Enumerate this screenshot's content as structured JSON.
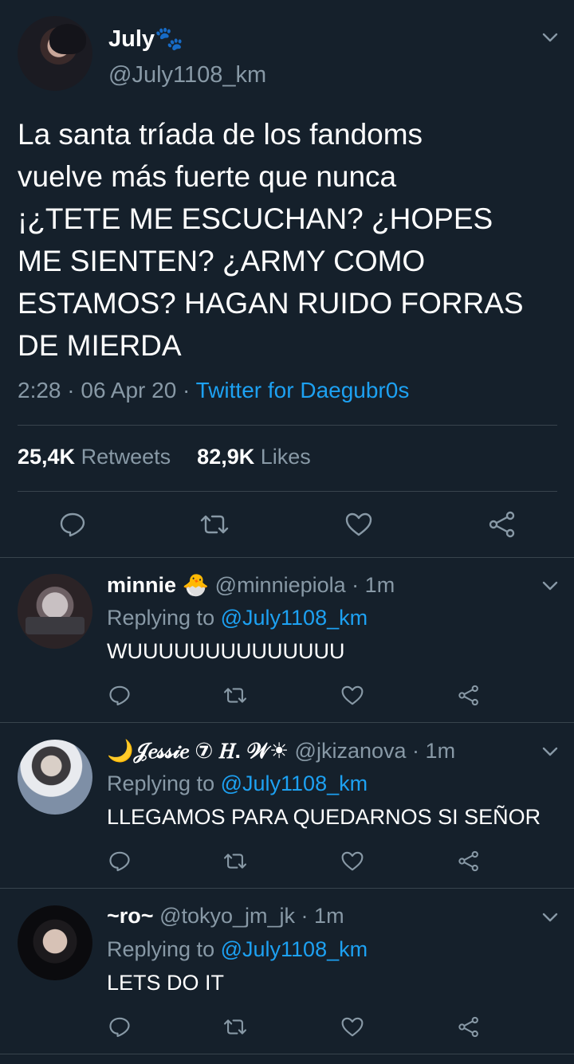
{
  "main_tweet": {
    "display_name": "July🐾",
    "handle": "@July1108_km",
    "text_lines": [
      "La santa tríada de los fandoms",
      "vuelve más fuerte que nunca",
      "¡¿TETE ME ESCUCHAN? ¿HOPES",
      "ME SIENTEN? ¿ARMY COMO",
      "ESTAMOS? HAGAN RUIDO FORRAS",
      "DE MIERDA"
    ],
    "time": "2:28",
    "date": "06 Apr 20",
    "source": "Twitter for Daegubr0s",
    "retweets_count": "25,4K",
    "retweets_label": "Retweets",
    "likes_count": "82,9K",
    "likes_label": "Likes"
  },
  "replies": [
    {
      "display_name": "minnie 🐣",
      "handle": "@minniepiola",
      "time": "1m",
      "replying_label": "Replying to",
      "replying_to": "@July1108_km",
      "text": "WUUUUUUUUUUUUUU"
    },
    {
      "display_name": "🌙𝒥𝑒𝓈𝓈𝒾𝑒 ⑦ 𝐻. 𝒲☀",
      "handle": "@jkizanova",
      "time": "1m",
      "replying_label": "Replying to",
      "replying_to": "@July1108_km",
      "text": "LLEGAMOS PARA QUEDARNOS SI SEÑOR"
    },
    {
      "display_name": "~ro~",
      "handle": "@tokyo_jm_jk",
      "time": "1m",
      "replying_label": "Replying to",
      "replying_to": "@July1108_km",
      "text": "LETS DO IT"
    }
  ],
  "icons": [
    "reply-icon",
    "retweet-icon",
    "like-icon",
    "share-icon",
    "chevron-down-icon"
  ],
  "colors": {
    "background": "#15202b",
    "accent": "#1da1f2",
    "muted": "#8899a6",
    "divider": "#38444d"
  }
}
